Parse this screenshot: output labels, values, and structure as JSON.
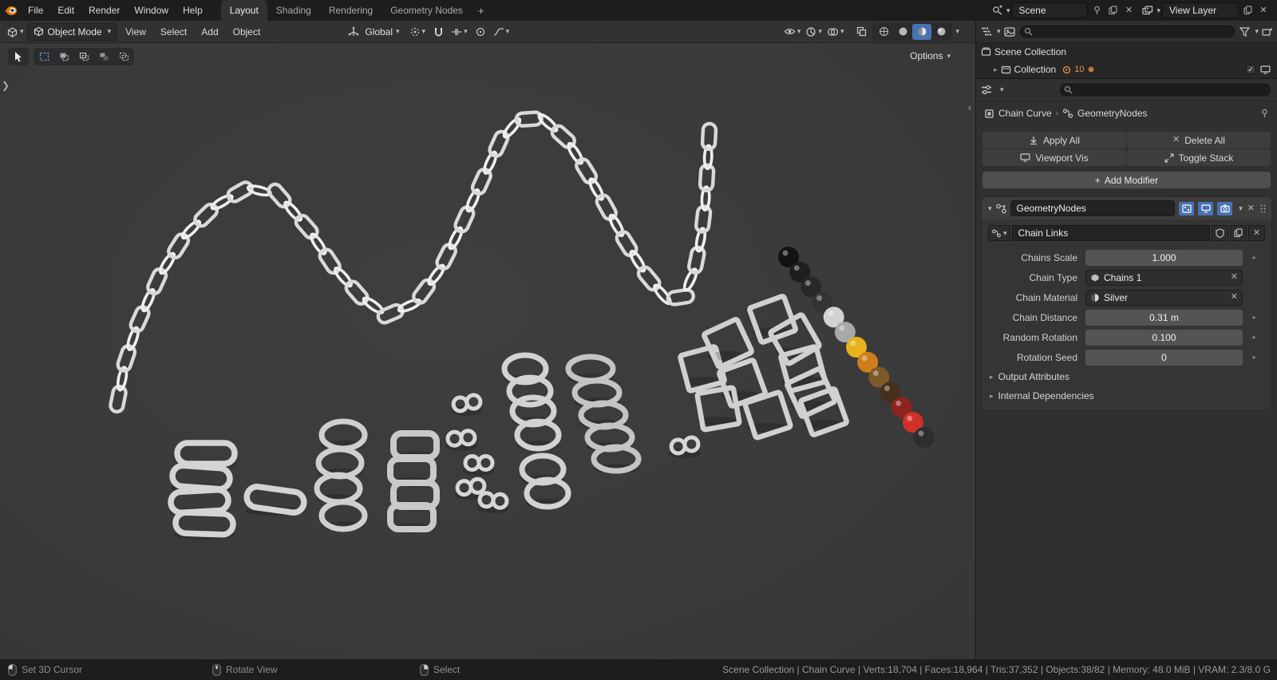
{
  "colors": {
    "accent": "#4772b3",
    "blender_orange": "#ea7600",
    "viewport_bg": "#3b3b3b",
    "topbar_bg": "#1d1d1d",
    "field_bg": "#545454"
  },
  "icons": {
    "plus": "+",
    "chevron_down": "▾",
    "tri_right": "▸",
    "bc_sep": "›",
    "close": "✕",
    "dot": "•",
    "check": "✓",
    "panel_open": "❯",
    "panel_close": "‹"
  },
  "topbar": {
    "menus": [
      "File",
      "Edit",
      "Render",
      "Window",
      "Help"
    ],
    "tabs": [
      "Layout",
      "Shading",
      "Rendering",
      "Geometry Nodes"
    ],
    "scene": "Scene",
    "view_layer": "View Layer"
  },
  "viewport": {
    "mode": "Object Mode",
    "menus": [
      "View",
      "Select",
      "Add",
      "Object"
    ],
    "orientation": "Global",
    "options": "Options",
    "beads": [
      "#121212",
      "#1e1e1e",
      "#282828",
      "#343434",
      "#d2d2d2",
      "#a8a8a8",
      "#e6b31e",
      "#cc7f1b",
      "#7d5a26",
      "#45301d",
      "#8c2420",
      "#d03028",
      "#2e2e2e"
    ]
  },
  "outliner": {
    "scene_collection": "Scene Collection",
    "collection": "Collection",
    "count": "10"
  },
  "properties": {
    "breadcrumb": {
      "object": "Chain Curve",
      "modifier": "GeometryNodes"
    },
    "apply_all": "Apply All",
    "delete_all": "Delete All",
    "viewport_vis": "Viewport Vis",
    "toggle_stack": "Toggle Stack",
    "add_modifier": "Add Modifier",
    "modifier": {
      "name": "GeometryNodes",
      "node_group": "Chain Links",
      "rows": [
        {
          "label": "Chains Scale",
          "value": "1.000"
        },
        {
          "label": "Chain Type",
          "value": "Chains 1"
        },
        {
          "label": "Chain Material",
          "value": "Silver"
        },
        {
          "label": "Chain Distance",
          "value": "0.31 m"
        },
        {
          "label": "Random Rotation",
          "value": "0.100"
        },
        {
          "label": "Rotation Seed",
          "value": "0"
        }
      ],
      "sections": [
        "Output Attributes",
        "Internal Dependencies"
      ]
    }
  },
  "statusbar": {
    "hints": [
      "Set 3D Cursor",
      "Rotate View",
      "Select"
    ],
    "stats": "Scene Collection | Chain Curve | Verts:18,704 | Faces:18,964 | Tris:37,352 | Objects:38/82 | Memory: 48.0 MiB | VRAM: 2.3/8.0 G"
  }
}
